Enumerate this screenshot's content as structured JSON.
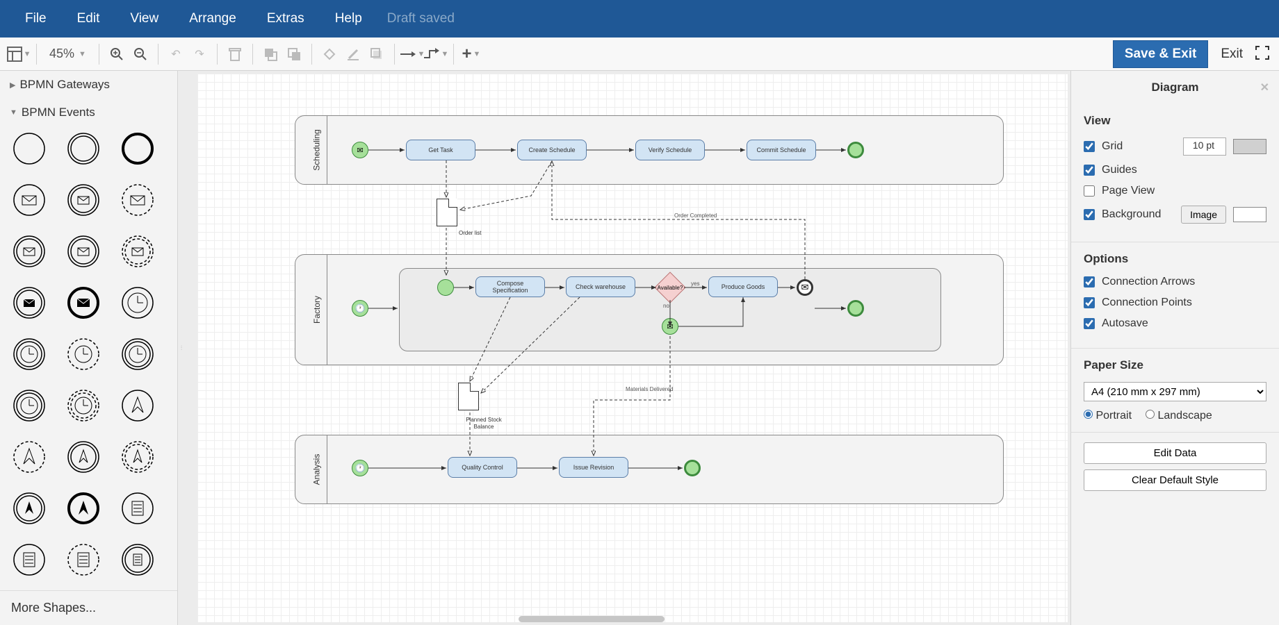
{
  "menu": {
    "file": "File",
    "edit": "Edit",
    "view": "View",
    "arrange": "Arrange",
    "extras": "Extras",
    "help": "Help",
    "status": "Draft saved"
  },
  "toolbar": {
    "zoom": "45%",
    "save_exit": "Save & Exit",
    "exit": "Exit"
  },
  "sidebar": {
    "group1": "BPMN Gateways",
    "group2": "BPMN Events",
    "more": "More Shapes..."
  },
  "diagram": {
    "pool1": "Scheduling",
    "pool2": "Factory",
    "pool3": "Analysis",
    "t1": "Get Task",
    "t2": "Create Schedule",
    "t3": "Verify Schedule",
    "t4": "Commit Schedule",
    "t5": "Compose Specification",
    "t6": "Check warehouse",
    "t7": "Produce Goods",
    "t8": "Quality Control",
    "t9": "Issue Revision",
    "gw": "Available?",
    "yes": "yes",
    "no": "no",
    "doc1": "Order list",
    "doc2": "Planned Stock Balance",
    "e1": "Order Completed",
    "e2": "Materials Delivered"
  },
  "panel": {
    "title": "Diagram",
    "view_h": "View",
    "grid": "Grid",
    "grid_val": "10 pt",
    "guides": "Guides",
    "pageview": "Page View",
    "background": "Background",
    "image_btn": "Image",
    "options_h": "Options",
    "conn_arrows": "Connection Arrows",
    "conn_points": "Connection Points",
    "autosave": "Autosave",
    "paper_h": "Paper Size",
    "paper_sel": "A4 (210 mm x 297 mm)",
    "portrait": "Portrait",
    "landscape": "Landscape",
    "edit_data": "Edit Data",
    "clear_style": "Clear Default Style"
  }
}
